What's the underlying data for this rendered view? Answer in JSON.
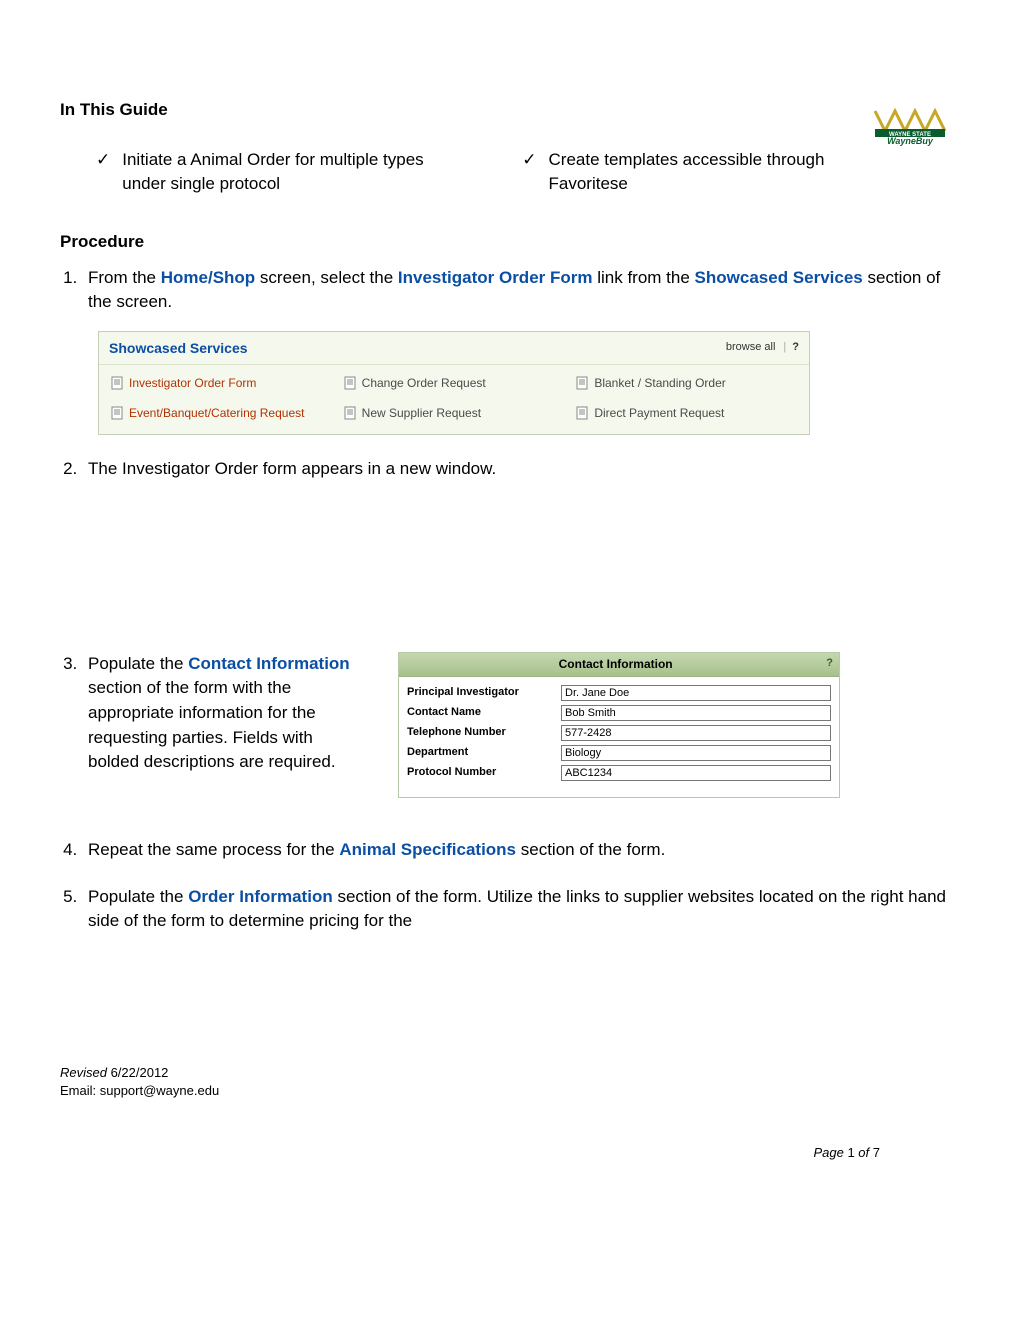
{
  "logo": {
    "brand": "WAYNE STATE",
    "sub": "WayneBuy"
  },
  "headings": {
    "in_this_guide": "In This Guide",
    "procedure": "Procedure"
  },
  "guide_items": [
    "Initiate a Animal Order for multiple types under single protocol",
    "Create templates accessible through Favoritese"
  ],
  "steps": {
    "s1_pre": "From the ",
    "s1_link1": "Home/Shop",
    "s1_mid1": " screen, select the ",
    "s1_link2": "Investigator Order Form",
    "s1_mid2": " link from the ",
    "s1_link3": "Showcased Services",
    "s1_post": " section of the screen.",
    "s2": "The Investigator Order form appears in a new window.",
    "s3_pre": "Populate the ",
    "s3_link": "Contact Information",
    "s3_post": " section of the form with the appropriate information for the requesting parties.  Fields with bolded descriptions are required.",
    "s4_pre": "Repeat the same process for the ",
    "s4_link": "Animal Specifications",
    "s4_post": " section of the form.",
    "s5_pre": "Populate the ",
    "s5_link": "Order Information",
    "s5_post": " section of the form.  Utilize the links to supplier websites located on the right hand side of the form to determine pricing for the"
  },
  "showcased": {
    "title": "Showcased Services",
    "browse_all": "browse all",
    "help": "?",
    "items": [
      {
        "label": "Investigator Order Form",
        "highlight": true
      },
      {
        "label": "Change Order Request",
        "highlight": false
      },
      {
        "label": "Blanket / Standing Order",
        "highlight": false
      },
      {
        "label": "Event/Banquet/Catering Request",
        "highlight": true
      },
      {
        "label": "New Supplier Request",
        "highlight": false
      },
      {
        "label": "Direct Payment Request",
        "highlight": false
      }
    ]
  },
  "contact_info": {
    "title": "Contact Information",
    "help": "?",
    "fields": [
      {
        "label": "Principal Investigator",
        "value": "Dr. Jane Doe"
      },
      {
        "label": "Contact Name",
        "value": "Bob Smith"
      },
      {
        "label": "Telephone Number",
        "value": "577-2428"
      },
      {
        "label": "Department",
        "value": "Biology"
      },
      {
        "label": "Protocol Number",
        "value": "ABC1234"
      }
    ]
  },
  "footer": {
    "revised_label": "Revised  ",
    "revised_date": "6/22/2012",
    "email_label": "Email:  ",
    "email_value": "support@wayne.edu"
  },
  "pager": {
    "page_label": "Page ",
    "page_num": "1",
    "of_label": " of ",
    "total": "7"
  }
}
